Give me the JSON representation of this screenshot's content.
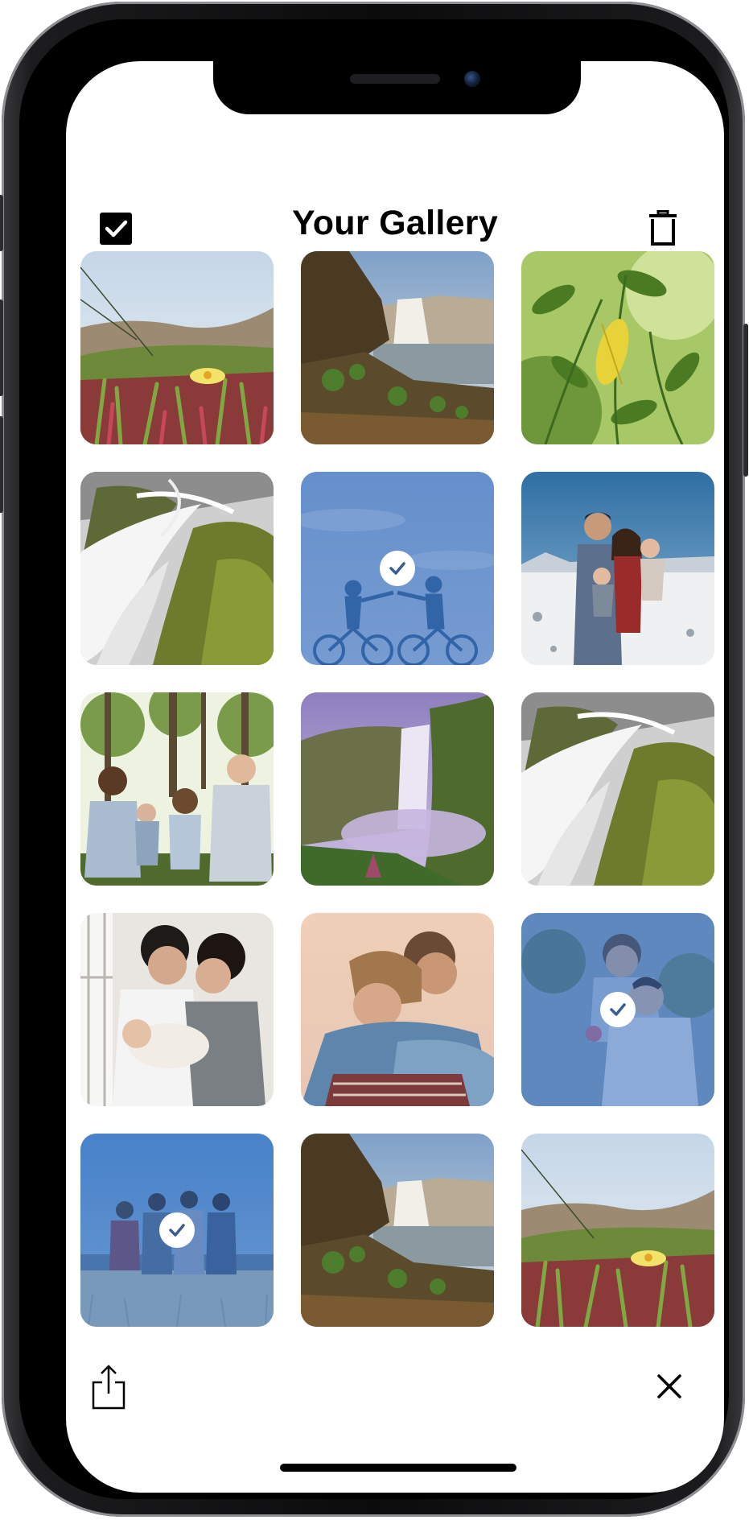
{
  "header": {
    "title": "Your Gallery",
    "select_icon": "checkbox-checked-icon",
    "delete_icon": "trash-icon"
  },
  "footer": {
    "share_icon": "share-icon",
    "close_icon": "close-icon"
  },
  "colors": {
    "selection_overlay": "#366ebe",
    "text": "#000000",
    "background": "#ffffff"
  },
  "gallery": {
    "photos": [
      {
        "subject": "meadow-flower",
        "selected": false
      },
      {
        "subject": "waterfall-cliff",
        "selected": false
      },
      {
        "subject": "green-leaves",
        "selected": false
      },
      {
        "subject": "waterfall-longexposure",
        "selected": false
      },
      {
        "subject": "cyclists-holding-hands",
        "selected": true
      },
      {
        "subject": "family-snow",
        "selected": false
      },
      {
        "subject": "family-forest",
        "selected": false
      },
      {
        "subject": "purple-waterfall",
        "selected": false
      },
      {
        "subject": "waterfall-longexposure",
        "selected": false
      },
      {
        "subject": "parents-newborn",
        "selected": false
      },
      {
        "subject": "couple-hug",
        "selected": false
      },
      {
        "subject": "couple-piggyback",
        "selected": true
      },
      {
        "subject": "friends-field",
        "selected": true
      },
      {
        "subject": "waterfall-cliff",
        "selected": false
      },
      {
        "subject": "meadow-flower",
        "selected": false
      }
    ]
  }
}
